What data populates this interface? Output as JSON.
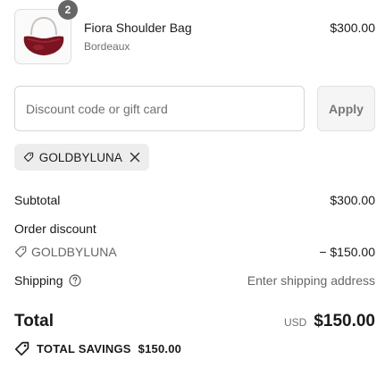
{
  "product": {
    "quantity": "2",
    "name": "Fiora Shoulder Bag",
    "variant": "Bordeaux",
    "price": "$300.00",
    "image_icon": "bag-product-image"
  },
  "discount": {
    "placeholder": "Discount code or gift card",
    "apply_label": "Apply",
    "applied_code": "GOLDBYLUNA"
  },
  "summary": {
    "subtotal_label": "Subtotal",
    "subtotal_value": "$300.00",
    "order_discount_label": "Order discount",
    "discount_code": "GOLDBYLUNA",
    "discount_value": "− $150.00",
    "shipping_label": "Shipping",
    "shipping_value": "Enter shipping address",
    "total_label": "Total",
    "currency": "USD",
    "total_value": "$150.00",
    "savings_label": "TOTAL SAVINGS",
    "savings_value": "$150.00"
  },
  "colors": {
    "badge": "#666666",
    "apply_bg": "#f5f5f5",
    "chip_bg": "#ededed",
    "bag": "#7a1420"
  }
}
